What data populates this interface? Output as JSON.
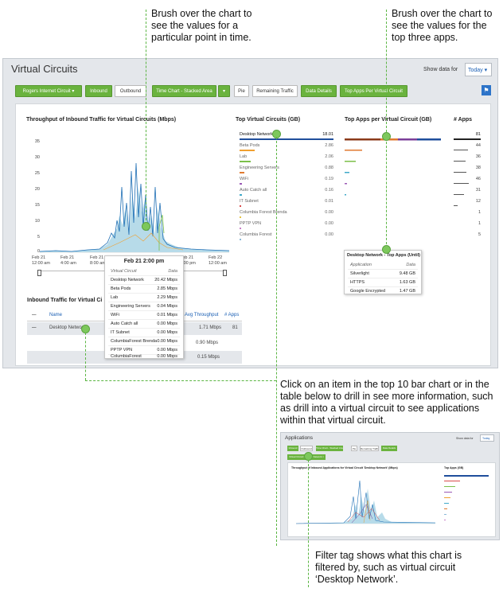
{
  "callouts": {
    "brush_time": "Brush over the chart to see the values for a particular point in time.",
    "brush_apps": "Brush over the chart to see the values for the top three apps.",
    "drill_in": "Click on an item in the top 10 bar chart or in the table below to drill in see more information, such as drill into a virtual circuit to see applications within that virtual circuit.",
    "filter_tag": "Filter tag shows what this chart is filtered by, such as virtual circuit ‘Desktop Network’."
  },
  "app": {
    "title": "Virtual Circuits",
    "show_data_label": "Show data for",
    "today_label": "Today ▾"
  },
  "toolbar": {
    "circuit": "Rogers Internet Circuit ▾",
    "inbound": "Inbound",
    "outbound": "Outbound",
    "chart_type": "Time Chart - Stacked Area",
    "pie": "Pie",
    "remaining": "Remaining Traffic",
    "data_details": "Data Details",
    "top_apps": "Top Apps Per Virtual Circuit",
    "help_icon": "⚑"
  },
  "throughput_chart": {
    "title": "Throughput of Inbound Traffic for Virtual Circuits (Mbps)",
    "y_ticks": [
      "35",
      "30",
      "25",
      "20",
      "15",
      "10",
      "5",
      "0"
    ],
    "x_ticks": [
      {
        "date": "Feb 21",
        "time": "12:00 am"
      },
      {
        "date": "Feb 21",
        "time": "4:00 am"
      },
      {
        "date": "Feb 21",
        "time": "8:00 am"
      },
      {
        "date": "Feb 21",
        "time": ""
      },
      {
        "date": "Feb 21",
        "time": "8:00 pm"
      },
      {
        "date": "Feb 22",
        "time": "12:00 am"
      }
    ]
  },
  "time_tooltip": {
    "header": "Feb 21 2:00 pm",
    "col_circuit": "Virtual Circuit",
    "col_data": "Data",
    "rows": [
      {
        "name": "Desktop Network",
        "value": "20.42 Mbps"
      },
      {
        "name": "Beta Pods",
        "value": "2.85 Mbps"
      },
      {
        "name": "Lab",
        "value": "2.29 Mbps"
      },
      {
        "name": "Engineering Servers",
        "value": "0.04 Mbps"
      },
      {
        "name": "WiFi",
        "value": "0.01 Mbps"
      },
      {
        "name": "Auto Catch all",
        "value": "0.00 Mbps"
      },
      {
        "name": "IT Subnet",
        "value": "0.00 Mbps"
      },
      {
        "name": "ColumbiaForest Brenda",
        "value": "0.00 Mbps"
      },
      {
        "name": "PPTP VPN",
        "value": "0.00 Mbps"
      },
      {
        "name": "ColumbiaForest",
        "value": "0.00 Mbps"
      }
    ]
  },
  "inbound_table": {
    "title": "Inbound Traffic for Virtual Ci",
    "col_name": "Name",
    "col_avg": "Avg Throughput",
    "col_apps": "# Apps",
    "rows": [
      {
        "name": "Desktop Network",
        "avg": "1.71 Mbps",
        "apps": "81"
      },
      {
        "name": "",
        "avg": "0.90 Mbps",
        "apps": ""
      },
      {
        "name": "",
        "avg": "0.15 Mbps",
        "apps": ""
      }
    ]
  },
  "top_circuits": {
    "title": "Top Virtual Circuits (GB)",
    "rows": [
      {
        "name": "Desktop Network",
        "value": "18.01",
        "color": "#1f4e9c"
      },
      {
        "name": "Beta Pods",
        "value": "2.86",
        "color": "#f0a030"
      },
      {
        "name": "Lab",
        "value": "2.06",
        "color": "#7cc04a"
      },
      {
        "name": "Engineering Servers",
        "value": "0.88",
        "color": "#e07a30"
      },
      {
        "name": "WiFi",
        "value": "0.19",
        "color": "#9b59b6"
      },
      {
        "name": "Auto Catch all",
        "value": "0.16",
        "color": "#3fa9c9"
      },
      {
        "name": "IT Subnet",
        "value": "0.01",
        "color": "#d94a4a"
      },
      {
        "name": "Columbia Forest Brenda",
        "value": "0.00",
        "color": "#e6c440"
      },
      {
        "name": "PPTP VPN",
        "value": "0.00",
        "color": "#c77dc7"
      },
      {
        "name": "Columbia Forest",
        "value": "0.00",
        "color": "#8bb8d8"
      }
    ]
  },
  "top_apps": {
    "title": "Top Apps per Virtual Circuit (GB)"
  },
  "num_apps": {
    "title": "# Apps",
    "values": [
      "81",
      "44",
      "36",
      "38",
      "46",
      "31",
      "12",
      "1",
      "1",
      "5"
    ]
  },
  "apps_tooltip": {
    "header": "Desktop Network - Top Apps (Until)",
    "col_app": "Application",
    "col_data": "Data",
    "rows": [
      {
        "name": "Silverlight",
        "value": "9.48 GB"
      },
      {
        "name": "HTTPS",
        "value": "1.63 GB"
      },
      {
        "name": "Google Encrypted",
        "value": "1.47 GB"
      }
    ]
  },
  "apps_screenshot": {
    "title": "Applications",
    "show_data_label": "Show data for",
    "today_label": "Today",
    "filter_tag": "Virtual Circuit Desktop Network ×",
    "chart_title": "Throughput of Inbound Applications for Virtual Circuit 'Desktop Network' (Mbps)",
    "top_apps_title": "Top Apps (GB)",
    "buttons": [
      "Inbound",
      "Outbound",
      "Time Chart - Stacked Area",
      "Pie",
      "Remaining Traffic",
      "Data Details"
    ]
  }
}
